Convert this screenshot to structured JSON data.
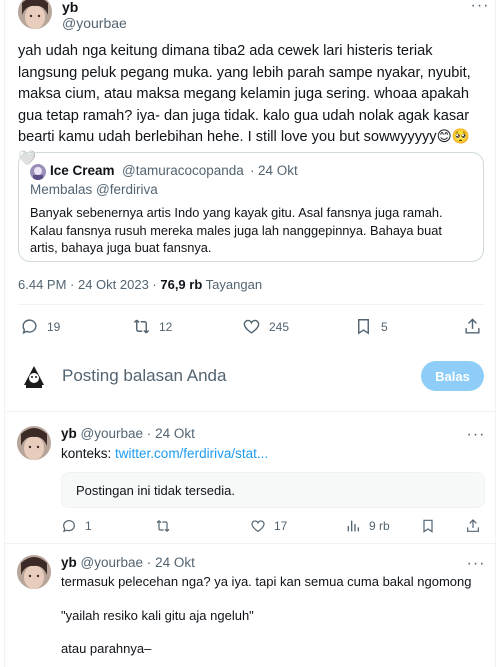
{
  "tweet": {
    "author_name": "yb",
    "author_handle": "@yourbae",
    "more_glyph": "···",
    "text": "yah udah nga keitung dimana tiba2 ada cewek lari histeris teriak langsung peluk pegang muka. yang lebih parah sampe nyakar, nyubit, maksa cium, atau maksa megang kelamin juga sering. whoaa apakah gua tetap ramah? iya- dan juga tidak. kalo gua udah nolak agak kasar bearti kamu udah berlebihan hehe. I still love you but sowwyyyyy😊🥺🤍",
    "quote": {
      "author_name": "Ice Cream",
      "author_handle": "@tamuracocopanda",
      "separator": "·",
      "date": "24 Okt",
      "reply_to": "Membalas @ferdiriva",
      "text": "Banyak sebenernya artis Indo yang kayak gitu. Asal fansnya juga ramah. Kalau fansnya rusuh mereka males juga lah nanggepinnya. Bahaya buat artis, bahaya juga buat fansnya."
    },
    "timestamp": "6.44 PM · 24 Okt 2023 ·",
    "views_count": "76,9 rb",
    "views_label": "Tayangan",
    "actions": {
      "replies": "19",
      "retweets": "12",
      "likes": "245",
      "bookmarks": "5"
    }
  },
  "composer": {
    "placeholder": "Posting balasan Anda",
    "button": "Balas"
  },
  "replies": [
    {
      "author_name": "yb",
      "author_handle": "@yourbae",
      "separator": "·",
      "date": "24 Okt",
      "context_label": "konteks:",
      "context_link": "twitter.com/ferdiriva/stat...",
      "unavailable": "Postingan ini tidak tersedia.",
      "actions": {
        "replies": "1",
        "likes": "17",
        "views": "9 rb"
      }
    },
    {
      "author_name": "yb",
      "author_handle": "@yourbae",
      "separator": "·",
      "date": "24 Okt",
      "line1": "termasuk pelecehan nga? ya iya. tapi kan semua cuma bakal ngomong",
      "line2": "\"yailah resiko kali gitu aja ngeluh\"",
      "line3": "atau parahnya–"
    }
  ]
}
